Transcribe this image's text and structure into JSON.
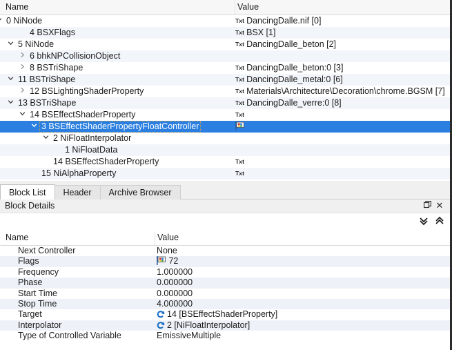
{
  "tree": {
    "columns": {
      "name": "Name",
      "value": "Value"
    },
    "rows": [
      {
        "indent": 0,
        "toggle": "open",
        "label": "0 NiNode",
        "badge": "Txt",
        "value": "DancingDalle.nif [0]"
      },
      {
        "indent": 2,
        "toggle": "none",
        "label": "4 BSXFlags",
        "badge": "Txt",
        "value": "BSX [1]"
      },
      {
        "indent": 1,
        "toggle": "open",
        "label": "5 NiNode",
        "badge": "Txt",
        "value": "DancingDalle_beton [2]"
      },
      {
        "indent": 2,
        "toggle": "closed",
        "label": "6 bhkNPCollisionObject",
        "badge": "",
        "value": ""
      },
      {
        "indent": 2,
        "toggle": "closed",
        "label": "8 BSTriShape",
        "badge": "Txt",
        "value": "DancingDalle_beton:0 [3]"
      },
      {
        "indent": 1,
        "toggle": "open",
        "label": "11 BSTriShape",
        "badge": "Txt",
        "value": "DancingDalle_metal:0 [6]"
      },
      {
        "indent": 2,
        "toggle": "closed",
        "label": "12 BSLightingShaderProperty",
        "badge": "Txt",
        "value": "Materials\\Architecture\\Decoration\\chrome.BGSM [7]"
      },
      {
        "indent": 1,
        "toggle": "open",
        "label": "13 BSTriShape",
        "badge": "Txt",
        "value": "DancingDalle_verre:0 [8]"
      },
      {
        "indent": 2,
        "toggle": "open",
        "label": "14 BSEffectShaderProperty",
        "badge": "Txt",
        "value": ""
      },
      {
        "indent": 3,
        "toggle": "open",
        "label": "3 BSEffectShaderPropertyFloatController",
        "badge": "",
        "value": "",
        "selected": true,
        "value_icon": "flag-icon"
      },
      {
        "indent": 4,
        "toggle": "open",
        "label": "2 NiFloatInterpolator",
        "badge": "",
        "value": ""
      },
      {
        "indent": 5,
        "toggle": "none",
        "label": "1 NiFloatData",
        "badge": "",
        "value": ""
      },
      {
        "indent": 4,
        "toggle": "none",
        "label": "14 BSEffectShaderProperty",
        "badge": "Txt",
        "value": ""
      },
      {
        "indent": 3,
        "toggle": "none",
        "label": "15 NiAlphaProperty",
        "badge": "Txt",
        "value": ""
      }
    ]
  },
  "tabs": [
    {
      "label": "Block List",
      "active": true
    },
    {
      "label": "Header",
      "active": false
    },
    {
      "label": "Archive Browser",
      "active": false
    }
  ],
  "block_details": {
    "panel_title": "Block Details",
    "float_label": "❐",
    "close_label": "✕",
    "expand_all_label": "»",
    "collapse_all_label": "»",
    "columns": {
      "name": "Name",
      "value": "Value"
    },
    "rows": [
      {
        "name": "Next Controller",
        "value": "None",
        "icon": ""
      },
      {
        "name": "Flags",
        "value": "72",
        "icon": "flag-icon"
      },
      {
        "name": "Frequency",
        "value": "1.000000",
        "icon": ""
      },
      {
        "name": "Phase",
        "value": "0.000000",
        "icon": ""
      },
      {
        "name": "Start Time",
        "value": "0.000000",
        "icon": ""
      },
      {
        "name": "Stop Time",
        "value": "4.000000",
        "icon": ""
      },
      {
        "name": "Target",
        "value": "14 [BSEffectShaderProperty]",
        "icon": "link-ref-icon"
      },
      {
        "name": "Interpolator",
        "value": "2 [NiFloatInterpolator]",
        "icon": "link-ref-icon"
      },
      {
        "name": "Type of Controlled Variable",
        "value": "EmissiveMultiple",
        "icon": ""
      }
    ]
  },
  "colors": {
    "selection": "#2a7fe0",
    "alt_row": "#f2f5fa",
    "header_bg": "#f7f7f7",
    "panel_border": "#2b2b2b"
  }
}
